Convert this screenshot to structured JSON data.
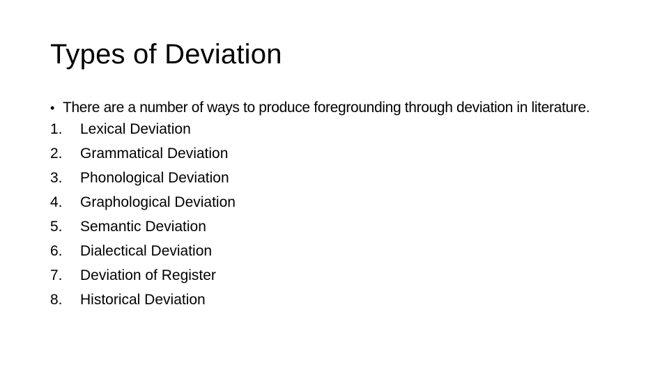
{
  "slide": {
    "title": "Types of Deviation",
    "intro": {
      "bullet": "•",
      "text": "There are a number of ways to produce foregrounding through deviation in literature."
    },
    "items": [
      {
        "number": "1.",
        "label": "Lexical Deviation"
      },
      {
        "number": "2.",
        "label": "Grammatical Deviation"
      },
      {
        "number": "3.",
        "label": "Phonological Deviation"
      },
      {
        "number": "4.",
        "label": "Graphological Deviation"
      },
      {
        "number": "5.",
        "label": "Semantic Deviation"
      },
      {
        "number": "6.",
        "label": "Dialectical Deviation"
      },
      {
        "number": "7.",
        "label": "Deviation of Register"
      },
      {
        "number": "8.",
        "label": "Historical Deviation"
      }
    ]
  }
}
